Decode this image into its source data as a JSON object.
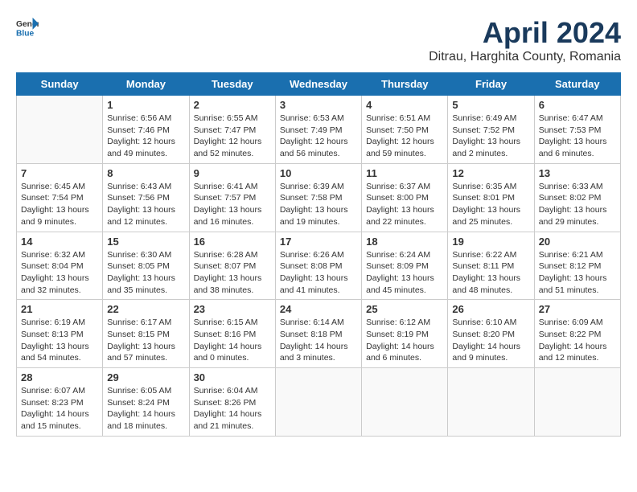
{
  "header": {
    "logo_general": "General",
    "logo_blue": "Blue",
    "title": "April 2024",
    "subtitle": "Ditrau, Harghita County, Romania"
  },
  "days_of_week": [
    "Sunday",
    "Monday",
    "Tuesday",
    "Wednesday",
    "Thursday",
    "Friday",
    "Saturday"
  ],
  "weeks": [
    [
      {
        "day": "",
        "info": ""
      },
      {
        "day": "1",
        "info": "Sunrise: 6:56 AM\nSunset: 7:46 PM\nDaylight: 12 hours\nand 49 minutes."
      },
      {
        "day": "2",
        "info": "Sunrise: 6:55 AM\nSunset: 7:47 PM\nDaylight: 12 hours\nand 52 minutes."
      },
      {
        "day": "3",
        "info": "Sunrise: 6:53 AM\nSunset: 7:49 PM\nDaylight: 12 hours\nand 56 minutes."
      },
      {
        "day": "4",
        "info": "Sunrise: 6:51 AM\nSunset: 7:50 PM\nDaylight: 12 hours\nand 59 minutes."
      },
      {
        "day": "5",
        "info": "Sunrise: 6:49 AM\nSunset: 7:52 PM\nDaylight: 13 hours\nand 2 minutes."
      },
      {
        "day": "6",
        "info": "Sunrise: 6:47 AM\nSunset: 7:53 PM\nDaylight: 13 hours\nand 6 minutes."
      }
    ],
    [
      {
        "day": "7",
        "info": "Sunrise: 6:45 AM\nSunset: 7:54 PM\nDaylight: 13 hours\nand 9 minutes."
      },
      {
        "day": "8",
        "info": "Sunrise: 6:43 AM\nSunset: 7:56 PM\nDaylight: 13 hours\nand 12 minutes."
      },
      {
        "day": "9",
        "info": "Sunrise: 6:41 AM\nSunset: 7:57 PM\nDaylight: 13 hours\nand 16 minutes."
      },
      {
        "day": "10",
        "info": "Sunrise: 6:39 AM\nSunset: 7:58 PM\nDaylight: 13 hours\nand 19 minutes."
      },
      {
        "day": "11",
        "info": "Sunrise: 6:37 AM\nSunset: 8:00 PM\nDaylight: 13 hours\nand 22 minutes."
      },
      {
        "day": "12",
        "info": "Sunrise: 6:35 AM\nSunset: 8:01 PM\nDaylight: 13 hours\nand 25 minutes."
      },
      {
        "day": "13",
        "info": "Sunrise: 6:33 AM\nSunset: 8:02 PM\nDaylight: 13 hours\nand 29 minutes."
      }
    ],
    [
      {
        "day": "14",
        "info": "Sunrise: 6:32 AM\nSunset: 8:04 PM\nDaylight: 13 hours\nand 32 minutes."
      },
      {
        "day": "15",
        "info": "Sunrise: 6:30 AM\nSunset: 8:05 PM\nDaylight: 13 hours\nand 35 minutes."
      },
      {
        "day": "16",
        "info": "Sunrise: 6:28 AM\nSunset: 8:07 PM\nDaylight: 13 hours\nand 38 minutes."
      },
      {
        "day": "17",
        "info": "Sunrise: 6:26 AM\nSunset: 8:08 PM\nDaylight: 13 hours\nand 41 minutes."
      },
      {
        "day": "18",
        "info": "Sunrise: 6:24 AM\nSunset: 8:09 PM\nDaylight: 13 hours\nand 45 minutes."
      },
      {
        "day": "19",
        "info": "Sunrise: 6:22 AM\nSunset: 8:11 PM\nDaylight: 13 hours\nand 48 minutes."
      },
      {
        "day": "20",
        "info": "Sunrise: 6:21 AM\nSunset: 8:12 PM\nDaylight: 13 hours\nand 51 minutes."
      }
    ],
    [
      {
        "day": "21",
        "info": "Sunrise: 6:19 AM\nSunset: 8:13 PM\nDaylight: 13 hours\nand 54 minutes."
      },
      {
        "day": "22",
        "info": "Sunrise: 6:17 AM\nSunset: 8:15 PM\nDaylight: 13 hours\nand 57 minutes."
      },
      {
        "day": "23",
        "info": "Sunrise: 6:15 AM\nSunset: 8:16 PM\nDaylight: 14 hours\nand 0 minutes."
      },
      {
        "day": "24",
        "info": "Sunrise: 6:14 AM\nSunset: 8:18 PM\nDaylight: 14 hours\nand 3 minutes."
      },
      {
        "day": "25",
        "info": "Sunrise: 6:12 AM\nSunset: 8:19 PM\nDaylight: 14 hours\nand 6 minutes."
      },
      {
        "day": "26",
        "info": "Sunrise: 6:10 AM\nSunset: 8:20 PM\nDaylight: 14 hours\nand 9 minutes."
      },
      {
        "day": "27",
        "info": "Sunrise: 6:09 AM\nSunset: 8:22 PM\nDaylight: 14 hours\nand 12 minutes."
      }
    ],
    [
      {
        "day": "28",
        "info": "Sunrise: 6:07 AM\nSunset: 8:23 PM\nDaylight: 14 hours\nand 15 minutes."
      },
      {
        "day": "29",
        "info": "Sunrise: 6:05 AM\nSunset: 8:24 PM\nDaylight: 14 hours\nand 18 minutes."
      },
      {
        "day": "30",
        "info": "Sunrise: 6:04 AM\nSunset: 8:26 PM\nDaylight: 14 hours\nand 21 minutes."
      },
      {
        "day": "",
        "info": ""
      },
      {
        "day": "",
        "info": ""
      },
      {
        "day": "",
        "info": ""
      },
      {
        "day": "",
        "info": ""
      }
    ]
  ]
}
